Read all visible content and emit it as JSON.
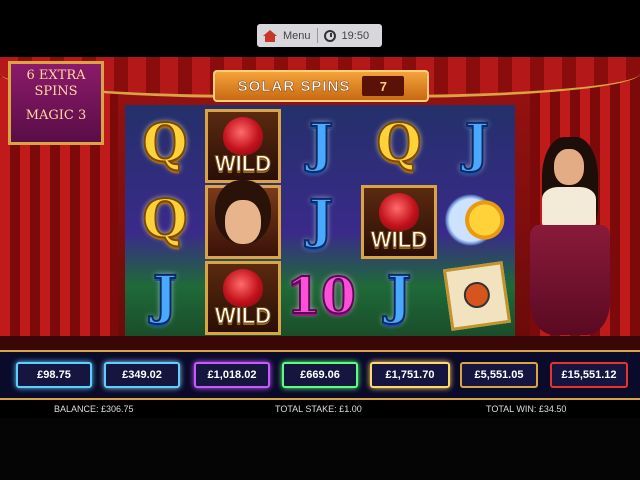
{
  "topbar": {
    "menu_label": "Menu",
    "time": "19:50"
  },
  "banner": {
    "extra_line1": "6 EXTRA",
    "extra_line2": "SPINS",
    "extra_line3": "MAGIC 3"
  },
  "solar_spins": {
    "label": "SOLAR SPINS",
    "count": "7"
  },
  "reels": [
    [
      "Q",
      "Q",
      "J"
    ],
    [
      "WILD",
      "portrait",
      "WILD"
    ],
    [
      "J",
      "J",
      "10"
    ],
    [
      "Q",
      "WILD",
      "J"
    ],
    [
      "J",
      "sun-moon",
      "tarot"
    ]
  ],
  "wild_label": "WILD",
  "symbols": {
    "q": "Q",
    "j": "J",
    "ten": "10"
  },
  "jackpots": [
    "£98.75",
    "£349.02",
    "£1,018.02",
    "£669.06",
    "£1,751.70",
    "£5,551.05",
    "£15,551.12"
  ],
  "footer": {
    "balance": "BALANCE: £306.75",
    "total_stake": "TOTAL STAKE: £1.00",
    "total_win": "TOTAL WIN: £34.50"
  }
}
